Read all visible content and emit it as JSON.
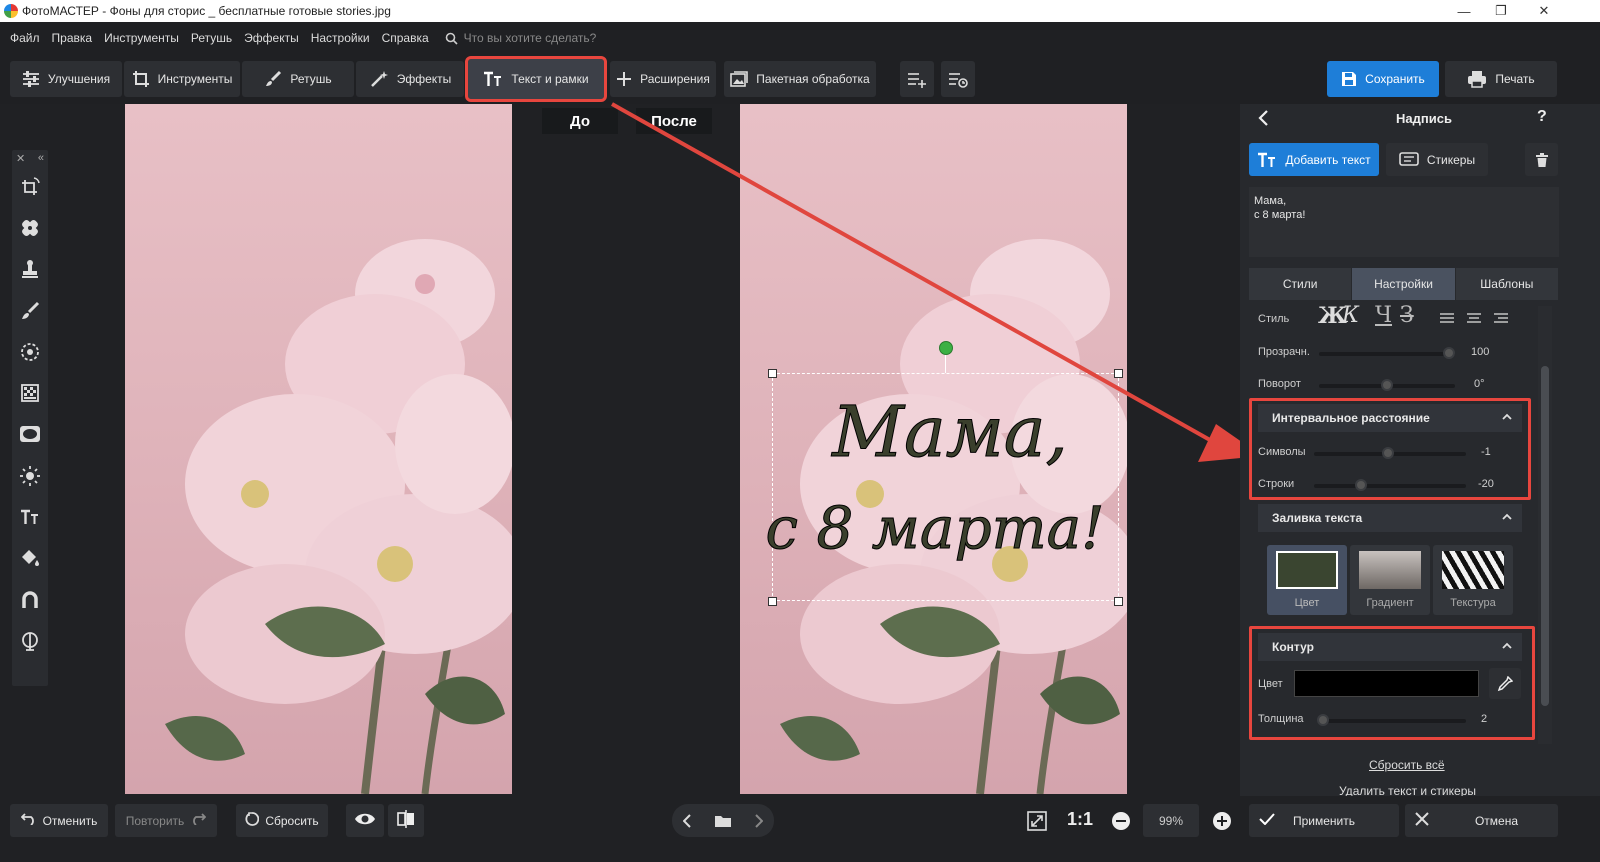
{
  "window": {
    "title": "ФотоМАСТЕР - Фоны для сторис _ бесплатные готовые stories.jpg",
    "minimize": "—",
    "restore": "❐",
    "close": "✕"
  },
  "menu": {
    "items": [
      "Файл",
      "Правка",
      "Инструменты",
      "Ретушь",
      "Эффекты",
      "Настройки",
      "Справка"
    ],
    "search_placeholder": "Что вы хотите сделать?"
  },
  "toolbar": {
    "tabs": [
      {
        "label": "Улучшения",
        "icon": "sliders-icon"
      },
      {
        "label": "Инструменты",
        "icon": "crop-icon"
      },
      {
        "label": "Ретушь",
        "icon": "brush-icon"
      },
      {
        "label": "Эффекты",
        "icon": "magic-wand-icon"
      },
      {
        "label": "Текст и рамки",
        "icon": "text-icon",
        "active": true
      },
      {
        "label": "Расширения",
        "icon": "plus-icon"
      },
      {
        "label": "Пакетная обработка",
        "icon": "batch-icon"
      }
    ],
    "save_label": "Сохранить",
    "print_label": "Печать"
  },
  "canvas": {
    "before_label": "До",
    "after_label": "После",
    "overlay_text_line1": "Мама,",
    "overlay_text_line2": "с 8 марта!",
    "text_color": "#3a3f2c"
  },
  "panel": {
    "title": "Надпись",
    "help": "?",
    "add_text_label": "Добавить текст",
    "stickers_label": "Стикеры",
    "text_content_line1": "Мама,",
    "text_content_line2": "с 8 марта!",
    "tabs": [
      "Стили",
      "Настройки",
      "Шаблоны"
    ],
    "selected_tab": "Настройки",
    "style_label": "Стиль",
    "style_glyphs": {
      "bold": "Ж",
      "italic": "К",
      "underline": "Ч",
      "strike": "З"
    },
    "opacity_label": "Прозрачн.",
    "opacity_value": "100",
    "rotation_label": "Поворот",
    "rotation_value": "0°",
    "spacing_section": "Интервальное расстояние",
    "chars_label": "Символы",
    "chars_value": "-1",
    "lines_label": "Строки",
    "lines_value": "-20",
    "fill_section": "Заливка текста",
    "fill_options": [
      "Цвет",
      "Градиент",
      "Текстура"
    ],
    "fill_color": "#3a4530",
    "outline_section": "Контур",
    "outline_color_label": "Цвет",
    "outline_color": "#000000",
    "thickness_label": "Толщина",
    "thickness_value": "2",
    "reset_all": "Сбросить всё",
    "delete_all": "Удалить текст и стикеры"
  },
  "bottom": {
    "undo_label": "Отменить",
    "redo_label": "Повторить",
    "reset_label": "Сбросить",
    "one_to_one": "1:1",
    "zoom_value": "99%",
    "apply_label": "Применить",
    "cancel_label": "Отмена"
  },
  "colors": {
    "accent": "#1e7ed8",
    "highlight": "#e8463e"
  }
}
